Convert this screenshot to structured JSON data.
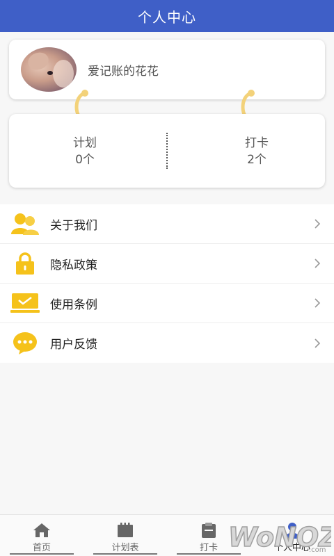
{
  "header": {
    "title": "个人中心"
  },
  "profile": {
    "username": "爱记账的花花",
    "avatar_icon": "avatar-image"
  },
  "stats": {
    "plan": {
      "label": "计划",
      "value": "0个"
    },
    "checkin": {
      "label": "打卡",
      "value": "2个"
    }
  },
  "menu": {
    "items": [
      {
        "label": "关于我们",
        "icon": "users-icon"
      },
      {
        "label": "隐私政策",
        "icon": "lock-icon"
      },
      {
        "label": "使用条例",
        "icon": "laptop-check-icon"
      },
      {
        "label": "用户反馈",
        "icon": "chat-bubble-icon"
      }
    ]
  },
  "tabbar": {
    "tabs": [
      {
        "label": "首页",
        "icon": "home-icon"
      },
      {
        "label": "计划表",
        "icon": "calendar-icon"
      },
      {
        "label": "打卡",
        "icon": "clipboard-icon"
      },
      {
        "label": "个人中心",
        "icon": "person-icon"
      }
    ],
    "active_index": 3
  },
  "watermark": {
    "text": "WoNOZ.com"
  },
  "colors": {
    "header_bg": "#3f5fc7",
    "accent_yellow": "#f5c21b",
    "clip_yellow": "#f3d27a"
  }
}
